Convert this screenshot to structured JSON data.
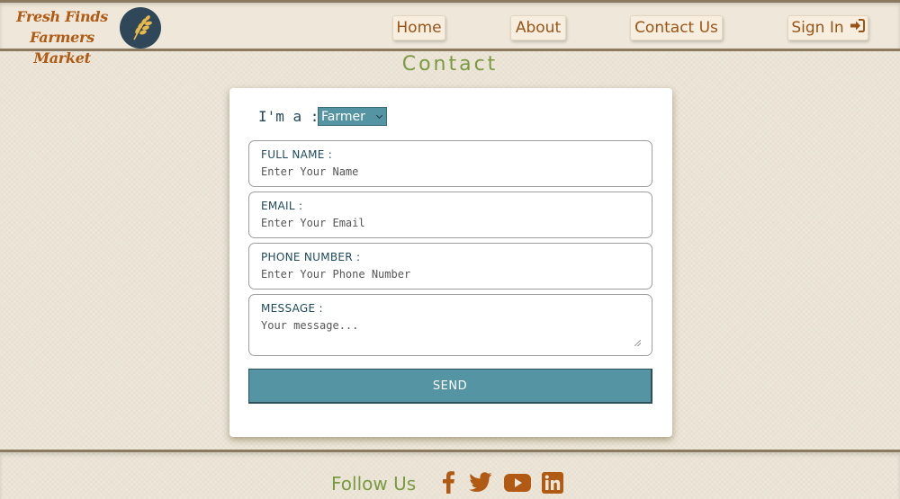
{
  "brand": {
    "line1": "Fresh Finds",
    "line2": "Farmers Market",
    "logo_icon": "wheat-icon"
  },
  "nav": {
    "items": [
      {
        "label": "Home"
      },
      {
        "label": "About"
      },
      {
        "label": "Contact Us"
      },
      {
        "label": "Sign In",
        "icon": "sign-in-icon"
      }
    ]
  },
  "page": {
    "title": "Contact"
  },
  "form": {
    "role_label": "I'm a :",
    "role_selected": "Farmer",
    "fields": [
      {
        "label": "FULL NAME :",
        "placeholder": "Enter Your Name"
      },
      {
        "label": "EMAIL :",
        "placeholder": "Enter Your Email"
      },
      {
        "label": "PHONE NUMBER :",
        "placeholder": "Enter Your Phone Number"
      },
      {
        "label": "MESSAGE :",
        "placeholder": "Your message..."
      }
    ],
    "submit_label": "SEND"
  },
  "footer": {
    "follow_label": "Follow Us",
    "social": [
      "facebook-icon",
      "twitter-icon",
      "youtube-icon",
      "linkedin-icon"
    ]
  },
  "colors": {
    "brand": "#b05a14",
    "accent_green": "#7a9a42",
    "teal": "#5594a3",
    "navy": "#2f4758",
    "background": "#efe8da"
  }
}
